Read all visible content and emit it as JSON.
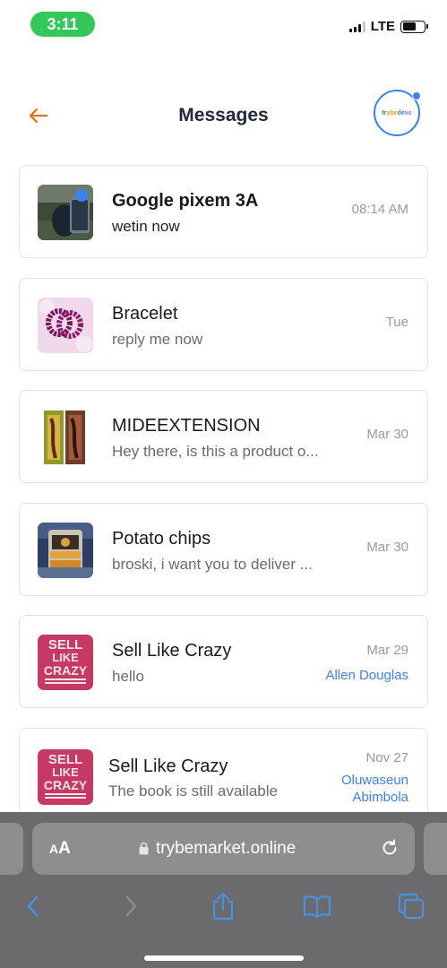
{
  "status_bar": {
    "time": "3:11",
    "network": "LTE"
  },
  "header": {
    "title": "Messages",
    "avatar_text": [
      "tr",
      "ybe",
      "dev",
      "s"
    ]
  },
  "conversations": [
    {
      "name": "Google pixem 3A",
      "preview": "wetin now",
      "time": "08:14 AM",
      "seller": "",
      "unread": true
    },
    {
      "name": "Bracelet",
      "preview": "reply me now",
      "time": "Tue",
      "seller": "",
      "unread": false
    },
    {
      "name": "MIDEEXTENSION",
      "preview": "Hey there, is this a product o...",
      "time": "Mar 30",
      "seller": "",
      "unread": false
    },
    {
      "name": "Potato chips",
      "preview": "broski, i want you to deliver ...",
      "time": "Mar 30",
      "seller": "",
      "unread": false
    },
    {
      "name": "Sell Like Crazy",
      "preview": "hello",
      "time": "Mar 29",
      "seller": "Allen Douglas",
      "unread": false
    },
    {
      "name": "Sell Like Crazy",
      "preview": "The book is still available",
      "time": "Nov 27",
      "seller_line1": "Oluwaseun",
      "seller_line2": "Abimbola",
      "unread": false
    }
  ],
  "thumb_text": {
    "book_line1": "SELL",
    "book_line2": "LIKE",
    "book_line3": "CRAZY"
  },
  "browser": {
    "text_size_small": "A",
    "text_size_big": "A",
    "url": "trybemarket.online"
  },
  "colors": {
    "accent": "#3b82f6",
    "back_arrow": "#d97706",
    "status_pill": "#34c759"
  }
}
